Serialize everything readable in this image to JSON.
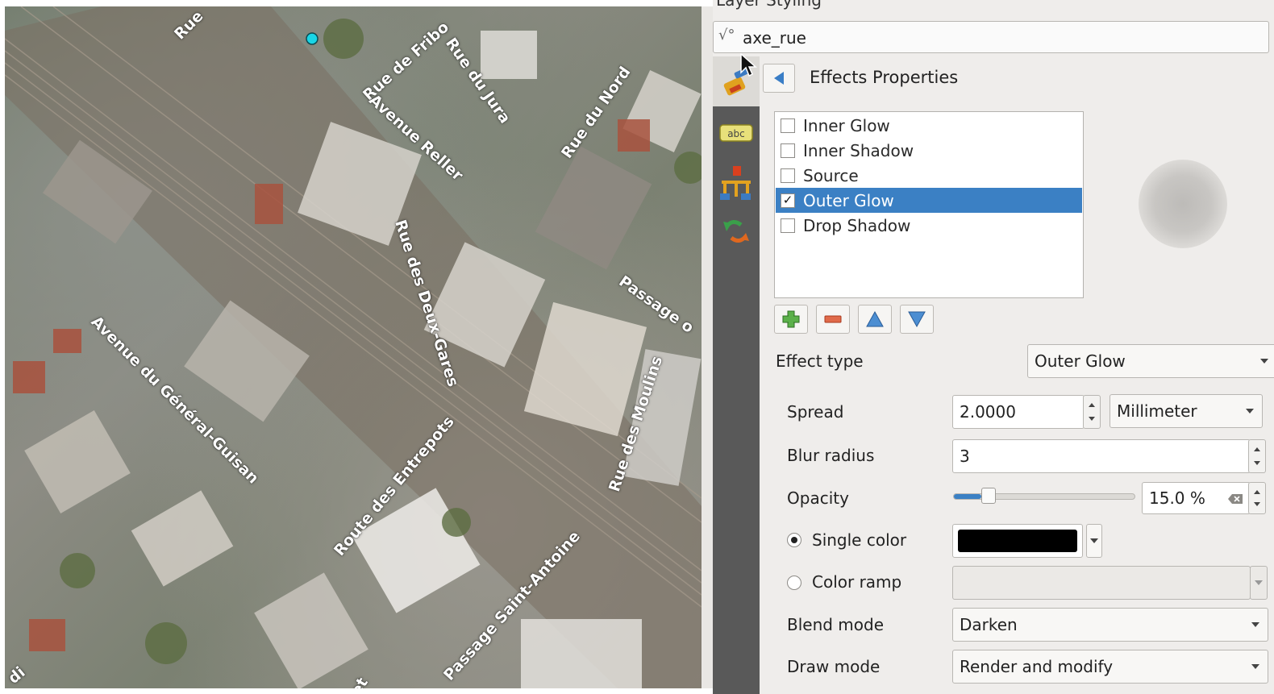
{
  "map": {
    "streets": [
      "Rue",
      "Rue de Fribo",
      "Rue du Jura",
      "Rue du Nord",
      "Avenue Reller",
      "Rue des Deux-Gares",
      "Passage o",
      "Avenue du Général-Guisan",
      "Route des Entrepots",
      "Rue des Moulins",
      "Passage Saint-Antoine",
      "et",
      "di"
    ]
  },
  "panel": {
    "title": "Layer Styling",
    "layer_name": "axe_rue",
    "section_title": "Effects Properties",
    "effects": [
      {
        "label": "Inner Glow",
        "checked": false,
        "selected": false
      },
      {
        "label": "Inner Shadow",
        "checked": false,
        "selected": false
      },
      {
        "label": "Source",
        "checked": false,
        "selected": false
      },
      {
        "label": "Outer Glow",
        "checked": true,
        "selected": true
      },
      {
        "label": "Drop Shadow",
        "checked": false,
        "selected": false
      }
    ],
    "effect_type_label": "Effect type",
    "effect_type_value": "Outer Glow",
    "spread_label": "Spread",
    "spread_value": "2.0000",
    "spread_unit": "Millimeter",
    "blur_label": "Blur radius",
    "blur_value": "3",
    "opacity_label": "Opacity",
    "opacity_value": "15.0 %",
    "opacity_fraction": 0.15,
    "single_color_label": "Single color",
    "color_value": "#000000",
    "color_ramp_label": "Color ramp",
    "blend_label": "Blend mode",
    "blend_value": "Darken",
    "draw_label": "Draw mode",
    "draw_value": "Render and modify"
  },
  "colors": {
    "selection": "#3b80c4",
    "tabbar": "#595959"
  }
}
